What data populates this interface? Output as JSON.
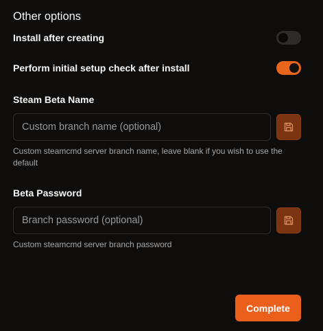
{
  "other_options": {
    "title": "Other options",
    "install_after_creating": {
      "label": "Install after creating",
      "enabled": false
    },
    "setup_check_after_install": {
      "label": "Perform initial setup check after install",
      "enabled": true
    }
  },
  "steam_beta_name": {
    "label": "Steam Beta Name",
    "value": "",
    "placeholder": "Custom branch name (optional)",
    "help": "Custom steamcmd server branch name, leave blank if you wish to use the default",
    "save_icon": "save-icon"
  },
  "beta_password": {
    "label": "Beta Password",
    "value": "",
    "placeholder": "Branch password (optional)",
    "help": "Custom steamcmd server branch password",
    "save_icon": "save-icon"
  },
  "actions": {
    "complete_label": "Complete"
  },
  "colors": {
    "background": "#0f0d0c",
    "accent": "#ea5f1b",
    "save_button": "#7a3412",
    "toggle_off": "#2e2b2a"
  }
}
